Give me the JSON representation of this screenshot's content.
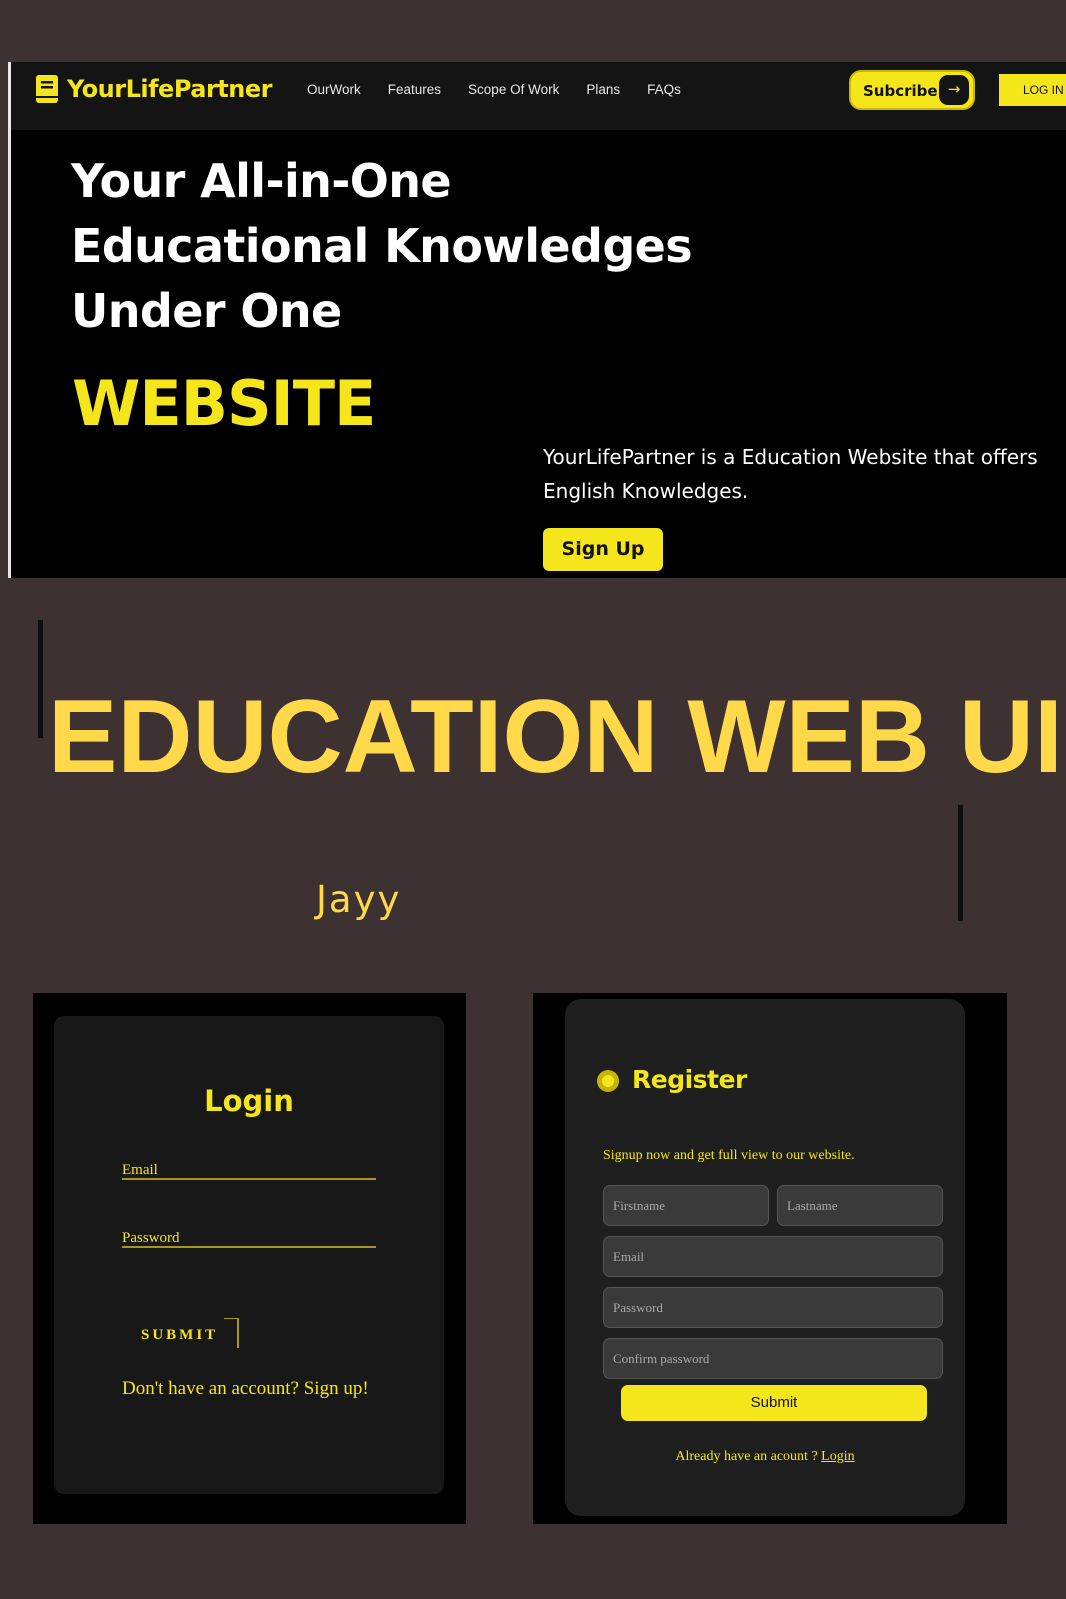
{
  "colors": {
    "accent": "#f5e61b",
    "background": "#3d3132",
    "title": "#ffd94a"
  },
  "brand": {
    "name": "YourLifePartner",
    "icon": "book-icon"
  },
  "nav": {
    "links": [
      "OurWork",
      "Features",
      "Scope Of Work",
      "Plans",
      "FAQs"
    ],
    "subscribe_label": "Subcribe",
    "subscribe_icon": "arrow-right-icon",
    "login_label": "LOG IN"
  },
  "hero": {
    "lines": [
      "Your All-in-One",
      "Educational Knowledges",
      "Under One"
    ],
    "accent": "WEBSITE",
    "description": "YourLifePartner is a Education Website that offers English Knowledges.",
    "cta_label": "Sign Up"
  },
  "showcase": {
    "title": "EDUCATION WEB UI",
    "author": "Jayy"
  },
  "login_form": {
    "title": "Login",
    "email_label": "Email",
    "password_label": "Password",
    "submit_label": "SUBMIT",
    "signup_text": "Don't have an account? Sign up!"
  },
  "register_form": {
    "title": "Register",
    "subtitle": "Signup now and get full view to our website.",
    "firstname_placeholder": "Firstname",
    "lastname_placeholder": "Lastname",
    "email_placeholder": "Email",
    "password_placeholder": "Password",
    "confirm_placeholder": "Confirm password",
    "submit_label": "Submit",
    "footer_text": "Already have an acount ?",
    "footer_link": "Login"
  }
}
